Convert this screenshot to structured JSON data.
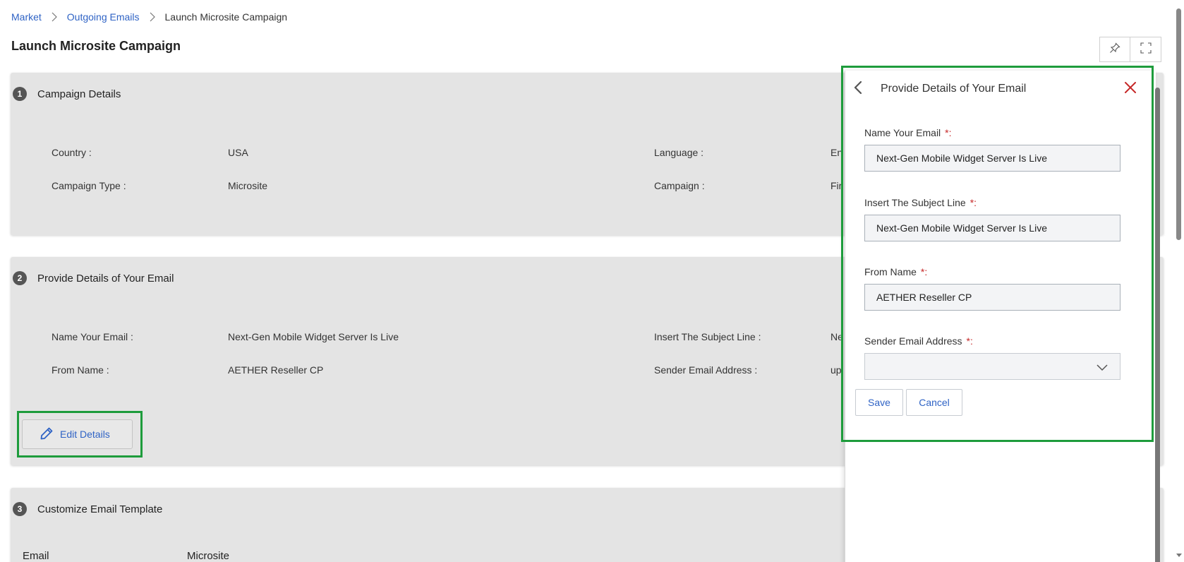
{
  "breadcrumb": {
    "items": [
      "Market",
      "Outgoing Emails"
    ],
    "current": "Launch Microsite Campaign"
  },
  "page_title": "Launch Microsite Campaign",
  "icons": {
    "pin": "pin-icon",
    "fullscreen": "expand-icon",
    "edit": "pencil-icon",
    "back": "chevron-left-icon",
    "close": "close-icon",
    "dropdown": "chevron-down-icon"
  },
  "colors": {
    "link": "#2f63c5",
    "highlight": "#1e9c3c",
    "close": "#c62828",
    "card_bg": "#e4e4e4"
  },
  "sections": [
    {
      "num": "1",
      "title": "Campaign Details",
      "fields": [
        {
          "label": "Country :",
          "value": "USA"
        },
        {
          "label": "Language :",
          "value": "En"
        },
        {
          "label": "Campaign Type :",
          "value": "Microsite"
        },
        {
          "label": "Campaign :",
          "value": "Fir"
        }
      ]
    },
    {
      "num": "2",
      "title": "Provide Details of Your Email",
      "fields": [
        {
          "label": "Name Your Email :",
          "value": "Next-Gen Mobile Widget Server Is Live"
        },
        {
          "label": "Insert The Subject Line :",
          "value": "Ne"
        },
        {
          "label": "From Name :",
          "value": "AETHER Reseller CP"
        },
        {
          "label": "Sender Email Address :",
          "value": "up"
        }
      ],
      "edit_label": "Edit Details"
    },
    {
      "num": "3",
      "title": "Customize Email Template",
      "tabs": [
        "Email",
        "Microsite"
      ]
    }
  ],
  "panel": {
    "title": "Provide Details of Your Email",
    "fields": [
      {
        "label": "Name Your Email",
        "required": "*:",
        "value": "Next-Gen Mobile Widget Server Is Live"
      },
      {
        "label": "Insert The Subject Line",
        "required": "*:",
        "value": "Next-Gen Mobile Widget Server Is Live"
      },
      {
        "label": "From Name",
        "required": "*:",
        "value": "AETHER Reseller CP"
      },
      {
        "label": "Sender Email Address",
        "required": "*:",
        "value": ""
      }
    ],
    "save_label": "Save",
    "cancel_label": "Cancel"
  }
}
